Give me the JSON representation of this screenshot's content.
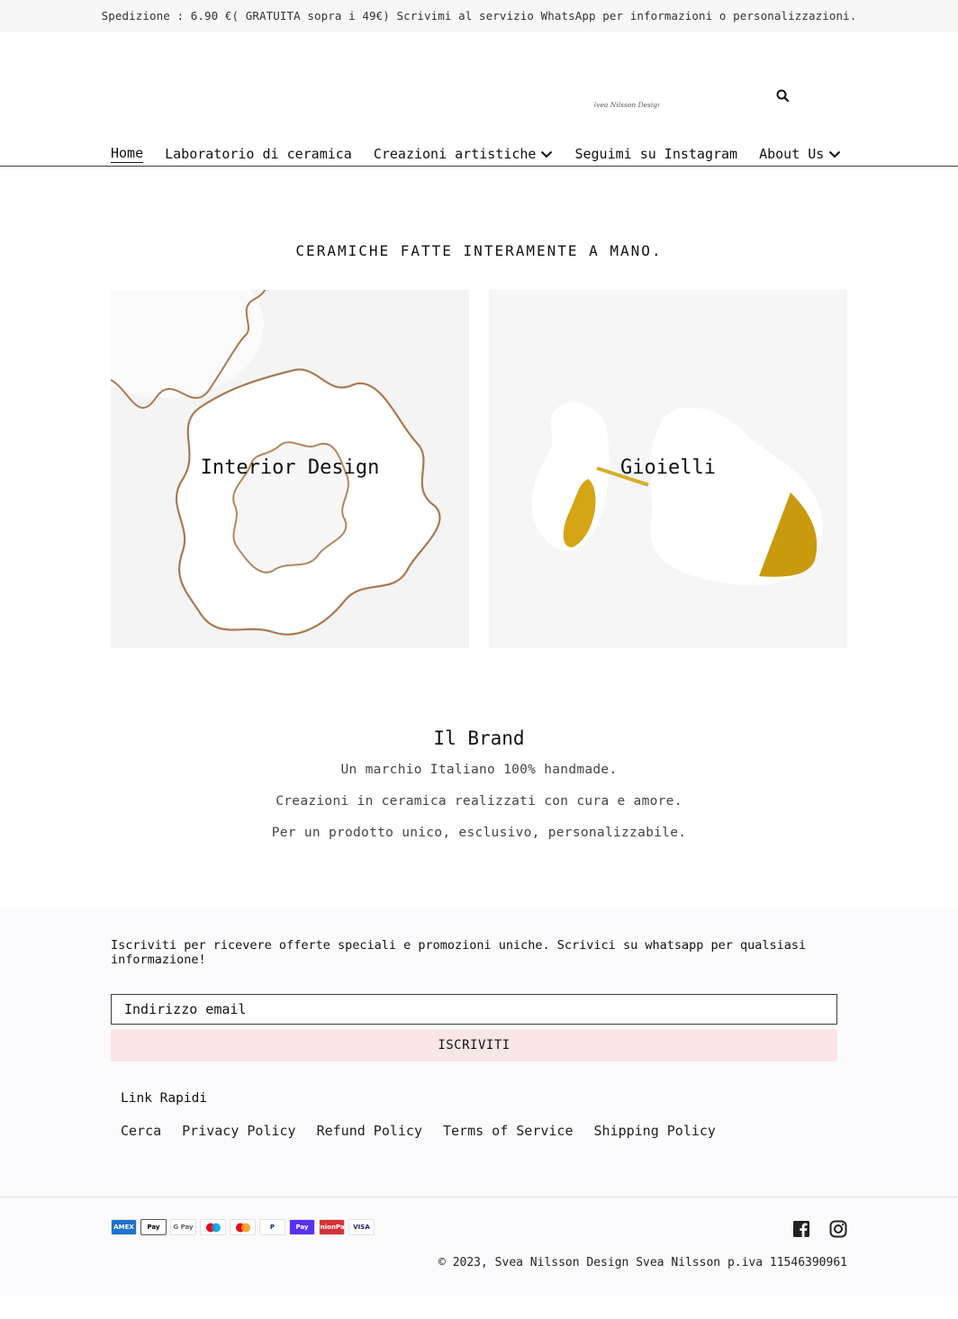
{
  "announcement": "Spedizione : 6.90 €( GRATUITA sopra i 49€) Scrivimi al servizio WhatsApp per informazioni o personalizzazioni.",
  "header": {
    "logo_text": "Svea Nilsson Design",
    "search_icon": "search-icon",
    "nav": [
      {
        "label": "Home",
        "active": true,
        "dropdown": false
      },
      {
        "label": "Laboratorio di ceramica",
        "active": false,
        "dropdown": false
      },
      {
        "label": "Creazioni artistiche",
        "active": false,
        "dropdown": true
      },
      {
        "label": "Seguimi su Instagram",
        "active": false,
        "dropdown": false
      },
      {
        "label": "About Us",
        "active": false,
        "dropdown": true
      }
    ]
  },
  "main": {
    "tagline": "CERAMICHE FATTE INTERAMENTE A MANO.",
    "collections": [
      {
        "title": "Interior Design",
        "image": "white ceramic wavy bowls with gold rim"
      },
      {
        "title": "Gioielli",
        "image": "white ceramic heart earrings with gold tips"
      }
    ],
    "brand": {
      "title": "Il Brand",
      "lines": [
        "Un marchio Italiano 100% handmade.",
        "Creazioni in ceramica realizzati con cura e amore.",
        "Per un prodotto unico, esclusivo, personalizzabile."
      ]
    }
  },
  "footer": {
    "newsletter_text": "Iscriviti per ricevere offerte speciali e promozioni uniche. Scrivici su whatsapp per qualsiasi informazione!",
    "email_placeholder": "Indirizzo email",
    "subscribe_label": "ISCRIVITI",
    "quick_links_title": "Link Rapidi",
    "quick_links": [
      "Cerca",
      "Privacy Policy",
      "Refund Policy",
      "Terms of Service",
      "Shipping Policy"
    ],
    "payments": [
      {
        "name": "amex",
        "label": "AMEX",
        "bg": "#1f72cd",
        "fg": "#ffffff"
      },
      {
        "name": "apple-pay",
        "label": "Pay",
        "bg": "#ffffff",
        "fg": "#000000"
      },
      {
        "name": "google-pay",
        "label": "G Pay",
        "bg": "#ffffff",
        "fg": "#5f6368"
      },
      {
        "name": "maestro",
        "label": "",
        "bg": "#ffffff",
        "fg": "#000000"
      },
      {
        "name": "mastercard",
        "label": "",
        "bg": "#ffffff",
        "fg": "#000000"
      },
      {
        "name": "paypal",
        "label": "P",
        "bg": "#ffffff",
        "fg": "#003087"
      },
      {
        "name": "shop-pay",
        "label": "Pay",
        "bg": "#5a31f4",
        "fg": "#ffffff"
      },
      {
        "name": "union-pay",
        "label": "UnionPay",
        "bg": "#d6313a",
        "fg": "#ffffff"
      },
      {
        "name": "visa",
        "label": "VISA",
        "bg": "#ffffff",
        "fg": "#1a1f71"
      }
    ],
    "socials": [
      "facebook",
      "instagram"
    ],
    "copyright": "© 2023, Svea Nilsson Design Svea Nilsson p.iva 11546390961"
  }
}
